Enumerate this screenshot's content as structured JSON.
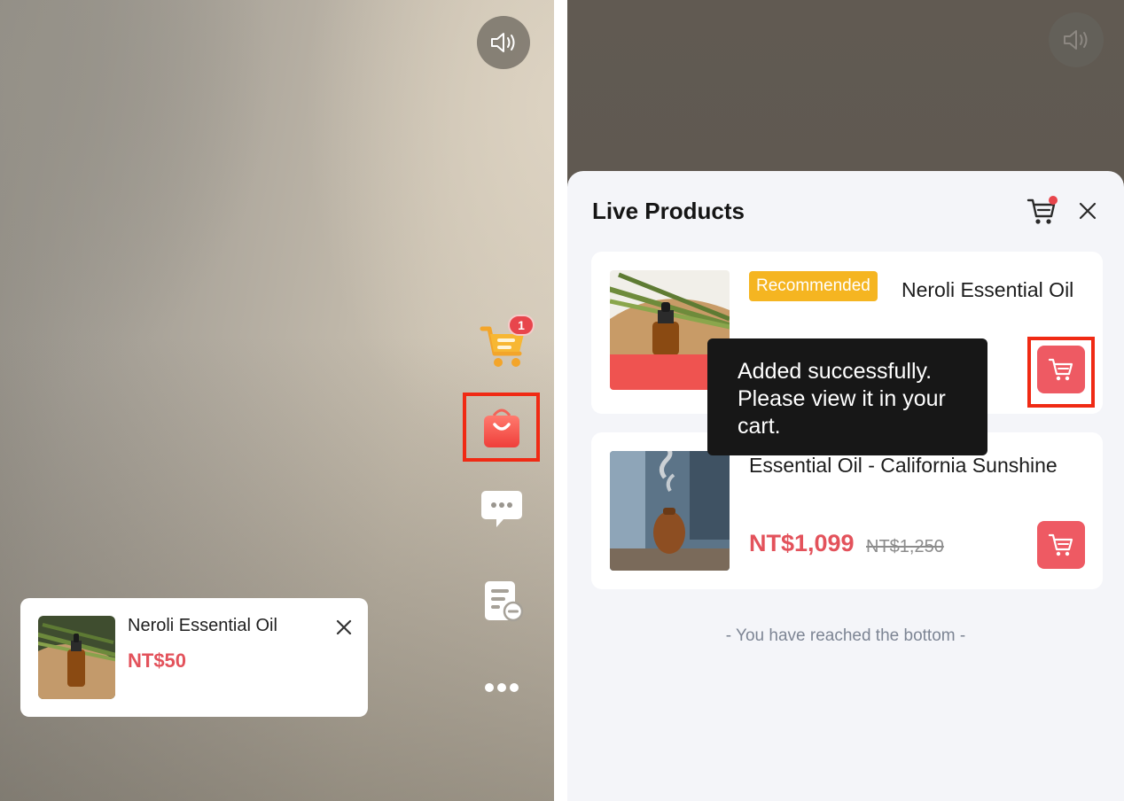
{
  "left_screen": {
    "side_actions": {
      "cart_badge_count": "1",
      "cart_icon": "cart-icon",
      "shopping_bag_icon": "shopping-bag-icon",
      "chat_icon": "chat-icon",
      "notes_icon": "notes-icon",
      "more_icon": "more-icon"
    },
    "sound_icon": "speaker-icon",
    "pinned_product": {
      "name": "Neroli Essential Oil",
      "price": "NT$50"
    }
  },
  "right_screen": {
    "sound_icon": "speaker-icon",
    "sheet": {
      "title": "Live Products",
      "products": [
        {
          "badge": "Recommended",
          "name": "Neroli Essential Oil",
          "button_icon": "add-to-cart-icon"
        },
        {
          "name": "Essential Oil - California Sunshine",
          "price": "NT$1,099",
          "original_price": "NT$1,250",
          "button_icon": "add-to-cart-icon"
        }
      ],
      "tooltip": "Added successfully. Please view it in your cart.",
      "bottom_note": "- You have reached the bottom -"
    }
  },
  "colors": {
    "accent_red": "#e3525b",
    "button_red": "#ee5a63",
    "badge_yellow": "#f5b521",
    "highlight": "#f02a14"
  }
}
